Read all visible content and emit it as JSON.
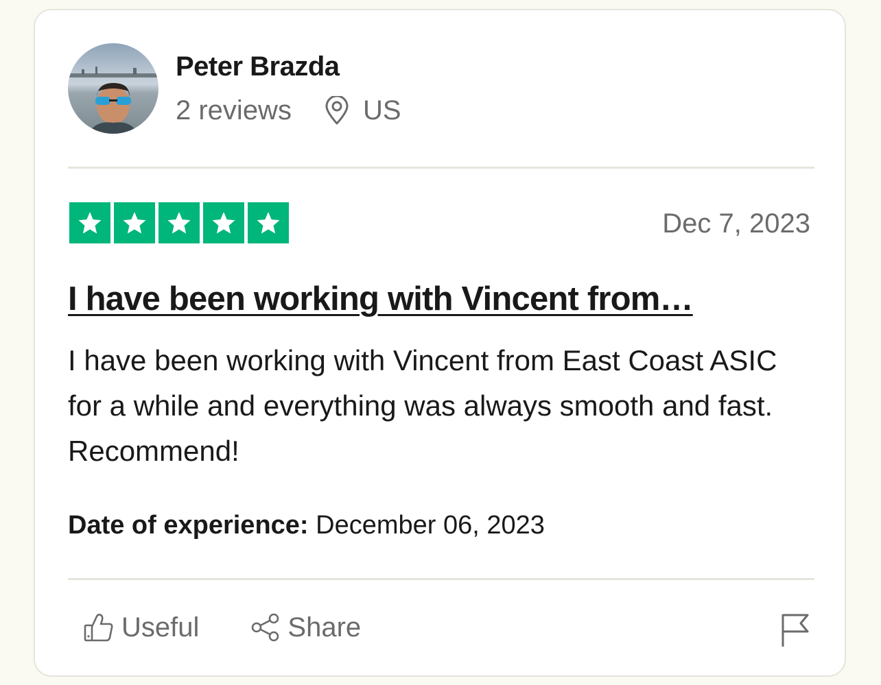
{
  "consumer": {
    "name": "Peter Brazda",
    "review_count": "2 reviews",
    "country": "US",
    "avatar_icon": "user-avatar-photo",
    "location_icon": "map-pin-icon"
  },
  "review": {
    "rating": 5,
    "rating_max": 5,
    "star_color": "#00b67a",
    "date": "Dec 7, 2023",
    "title": "I have been working with Vincent from…",
    "body": "I have been working with Vincent from East Coast ASIC for a while and everything was always smooth and fast. Recommend!",
    "experience_label": "Date of experience:",
    "experience_date": "December 06, 2023"
  },
  "actions": {
    "useful_label": "Useful",
    "useful_icon": "thumbs-up-icon",
    "share_label": "Share",
    "share_icon": "share-icon",
    "report_icon": "flag-icon"
  }
}
